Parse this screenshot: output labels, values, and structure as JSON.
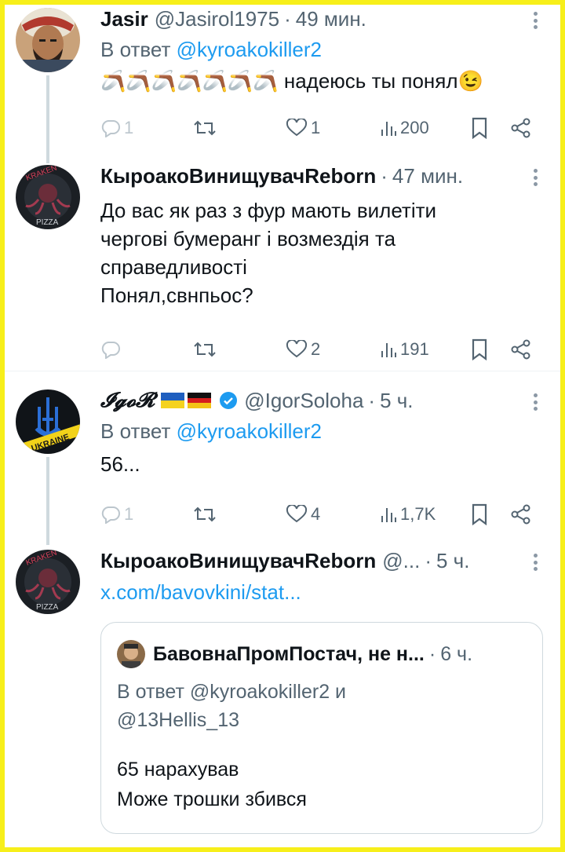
{
  "tweets": [
    {
      "name": "Jasir",
      "handle": "@Jasirol1975",
      "time": "49 мин.",
      "reply_label": "В ответ",
      "reply_mention": "@kyroakokiller2",
      "text": "надеюсь ты понял",
      "emoji_prefix": "🪃🪃🪃🪃🪃🪃🪃",
      "emoji_suffix": "😉",
      "replies": "1",
      "retweets": "",
      "likes": "1",
      "views": "200"
    },
    {
      "name": "КыроакоВинищувачReborn",
      "time": "47 мин.",
      "text_lines": [
        "До вас як раз з фур мають вилетіти",
        "чергові бумеранг і возмездія та",
        "справедливості",
        "Понял,свнпьос?"
      ],
      "replies": "",
      "retweets": "",
      "likes": "2",
      "views": "191"
    },
    {
      "name": "𝓘𝓰𝓸𝓡",
      "handle": "@IgorSoloha",
      "time": "5 ч.",
      "reply_label": "В ответ",
      "reply_mention": "@kyroakokiller2",
      "text": "56...",
      "replies": "1",
      "retweets": "",
      "likes": "4",
      "views": "1,7K"
    },
    {
      "name": "КыроакоВинищувачReborn",
      "handle": "@...",
      "time": "5 ч.",
      "link": "x.com/bavovkini/stat..."
    }
  ],
  "quote": {
    "name": "БавовнаПромПостач, не н...",
    "time": "6 ч.",
    "reply_line1": "В ответ @kyroakokiller2 и",
    "reply_line2": "@13Hellis_13",
    "text_line1": "65 нарахував",
    "text_line2": "Може трошки збився"
  },
  "icons": {
    "reply": "reply-icon",
    "retweet": "retweet-icon",
    "like": "heart-icon",
    "views": "views-icon",
    "bookmark": "bookmark-icon",
    "share": "share-icon",
    "more": "more-icon",
    "verified": "verified-badge-icon"
  },
  "colors": {
    "accent": "#1d9bf0",
    "muted": "#536471",
    "frame": "#f7ef1a"
  }
}
